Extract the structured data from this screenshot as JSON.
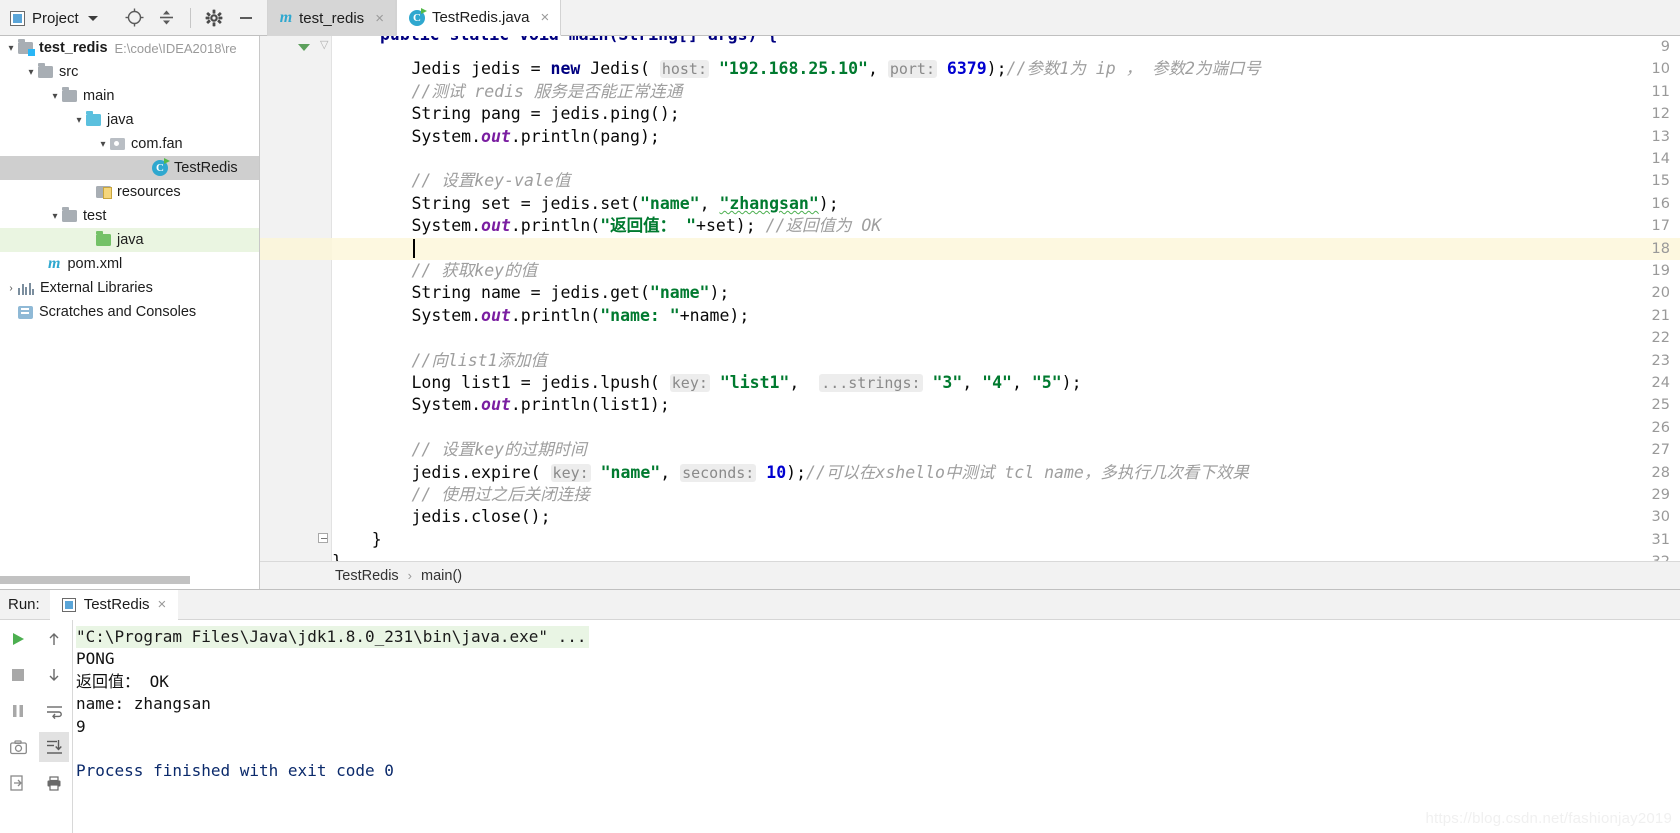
{
  "topbar": {
    "project_label": "Project",
    "icons": [
      "locate-icon",
      "collapse-all-icon",
      "settings-gear-icon",
      "minimize-icon"
    ]
  },
  "tabs": [
    {
      "label": "test_redis",
      "icon": "maven-m-icon",
      "active": false,
      "close": "×"
    },
    {
      "label": "TestRedis.java",
      "icon": "java-class-icon",
      "active": true,
      "close": "×"
    }
  ],
  "tree": {
    "items": [
      {
        "label": "test_redis",
        "path": "E:\\code\\IDEA2018\\re",
        "icon": "project-folder-icon",
        "depth": 0,
        "arrow": "▾",
        "bold": true
      },
      {
        "label": "src",
        "icon": "folder-icon",
        "depth": 1,
        "arrow": "▾"
      },
      {
        "label": "main",
        "icon": "folder-icon",
        "depth": 2,
        "arrow": "▾"
      },
      {
        "label": "java",
        "icon": "source-folder-icon",
        "depth": 3,
        "arrow": "▾"
      },
      {
        "label": "com.fan",
        "icon": "package-icon",
        "depth": 4,
        "arrow": "▾"
      },
      {
        "label": "TestRedis",
        "icon": "java-class-icon",
        "depth": 5,
        "arrow": "",
        "selected": "gray"
      },
      {
        "label": "resources",
        "icon": "resources-folder-icon",
        "depth": 4,
        "arrow": ""
      },
      {
        "label": "test",
        "icon": "folder-icon",
        "depth": 3,
        "arrow": "▾"
      },
      {
        "label": "java",
        "icon": "test-source-folder-icon",
        "depth": 4,
        "arrow": "",
        "selected": "green"
      },
      {
        "label": "pom.xml",
        "icon": "maven-m-icon",
        "depth": 2,
        "arrow": ""
      },
      {
        "label": "External Libraries",
        "icon": "libraries-icon",
        "depth": 0,
        "arrow": "›"
      },
      {
        "label": "Scratches and Consoles",
        "icon": "scratches-icon",
        "depth": 0,
        "arrow": ""
      }
    ]
  },
  "editor": {
    "first_visible_line": 9,
    "highlighted_line": 18,
    "caret_line": 18,
    "lines": [
      {
        "n": 9,
        "partial": true
      },
      {
        "n": 10
      },
      {
        "n": 11
      },
      {
        "n": 12
      },
      {
        "n": 13
      },
      {
        "n": 14
      },
      {
        "n": 15
      },
      {
        "n": 16
      },
      {
        "n": 17
      },
      {
        "n": 18
      },
      {
        "n": 19
      },
      {
        "n": 20
      },
      {
        "n": 21
      },
      {
        "n": 22
      },
      {
        "n": 23
      },
      {
        "n": 24
      },
      {
        "n": 25
      },
      {
        "n": 26
      },
      {
        "n": 27
      },
      {
        "n": 28
      },
      {
        "n": 29
      },
      {
        "n": 30
      },
      {
        "n": 31
      },
      {
        "n": 32
      }
    ],
    "code": {
      "l9_text": "public static void main(String[] args) {",
      "l10_kw": "new",
      "l10_a": "        Jedis jedis = ",
      "l10_b": " Jedis( ",
      "l10_hint_host": "host:",
      "l10_ip": "\"192.168.25.10\"",
      "l10_c": ", ",
      "l10_hint_port": "port:",
      "l10_port": "6379",
      "l10_d": ");",
      "l10_cmt": "//参数1为 ip ， 参数2为端口号",
      "l11_cmt": "        //测试 redis 服务是否能正常连通",
      "l12_text": "        String pang = jedis.ping();",
      "l13_a": "        System.",
      "l13_out": "out",
      "l13_b": ".println(pang);",
      "l15_cmt": "        // 设置key-vale值",
      "l16_a": "        String set = jedis.set(",
      "l16_s1": "\"name\"",
      "l16_b": ", ",
      "l16_s2": "\"zhangsan\"",
      "l16_c": ");",
      "l17_a": "        System.",
      "l17_out": "out",
      "l17_b": ".println(",
      "l17_s": "\"返回值： \"",
      "l17_c": "+set); ",
      "l17_cmt": "//返回值为 OK",
      "l19_cmt": "        // 获取key的值",
      "l20_a": "        String name = jedis.get(",
      "l20_s": "\"name\"",
      "l20_b": ");",
      "l21_a": "        System.",
      "l21_out": "out",
      "l21_b": ".println(",
      "l21_s": "\"name: \"",
      "l21_c": "+name);",
      "l23_cmt": "        //向list1添加值",
      "l24_a": "        Long list1 = jedis.lpush( ",
      "l24_hint_key": "key:",
      "l24_s1": "\"list1\"",
      "l24_b": ",  ",
      "l24_hint_strings": "...strings:",
      "l24_s2": "\"3\"",
      "l24_c": ", ",
      "l24_s3": "\"4\"",
      "l24_d": ", ",
      "l24_s4": "\"5\"",
      "l24_e": ");",
      "l25_a": "        System.",
      "l25_out": "out",
      "l25_b": ".println(list1);",
      "l27_cmt": "        // 设置key的过期时间",
      "l28_a": "        jedis.expire( ",
      "l28_hint_key": "key:",
      "l28_s": "\"name\"",
      "l28_b": ", ",
      "l28_hint_seconds": "seconds:",
      "l28_num": "10",
      "l28_c": ");",
      "l28_cmt": "//可以在xshello中测试 tcl name，多执行几次看下效果",
      "l29_cmt": "        // 使用过之后关闭连接",
      "l30_text": "        jedis.close();",
      "l31_text": "    }",
      "l32_text": "}"
    }
  },
  "breadcrumb": {
    "class": "TestRedis",
    "sep": "›",
    "method": "main()"
  },
  "run": {
    "label": "Run:",
    "tab_label": "TestRedis",
    "tab_close": "×",
    "toolbar_icons": [
      "run-icon",
      "stop-icon",
      "pause-icon",
      "camera-icon",
      "rerun-icon",
      "up-arrow-icon",
      "down-arrow-icon",
      "soft-wrap-icon",
      "scroll-to-end-icon",
      "print-icon"
    ],
    "console": [
      {
        "text": "\"C:\\Program Files\\Java\\jdk1.8.0_231\\bin\\java.exe\" ...",
        "style": "cmdline"
      },
      {
        "text": "PONG",
        "style": "normal"
      },
      {
        "text": "返回值： OK",
        "style": "normal"
      },
      {
        "text": "name: zhangsan",
        "style": "normal"
      },
      {
        "text": "9",
        "style": "normal"
      },
      {
        "text": "",
        "style": "normal"
      },
      {
        "text": "Process finished with exit code 0",
        "style": "finish"
      }
    ]
  },
  "watermark": "https://blog.csdn.net/fashionjay2019",
  "colors": {
    "keyword": "#000080",
    "string": "#007a2f",
    "number": "#0000d0",
    "comment": "#9e9e9e",
    "field": "#7a1ea1",
    "accent": "#2fa8cf",
    "highlight_line": "#fdf8e0",
    "console_cmd_bg": "#e9f5e4"
  }
}
